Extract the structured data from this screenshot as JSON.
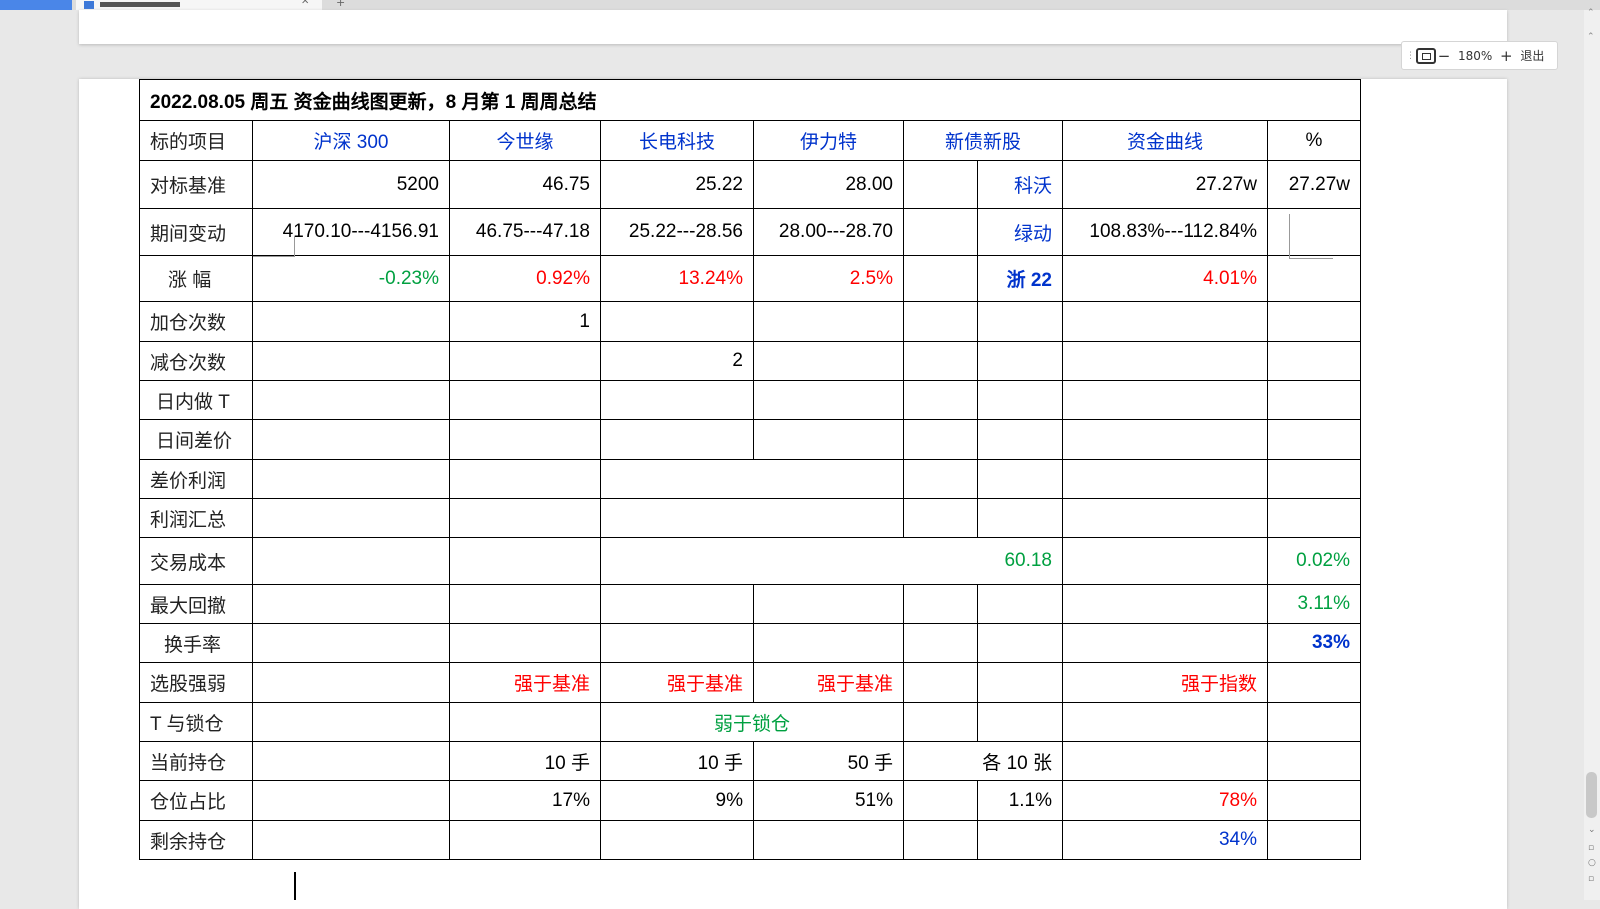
{
  "toolbar": {
    "zoom": "180%",
    "exit_label": "退出",
    "zoom_out": "−",
    "zoom_in": "+"
  },
  "title": "2022.08.05  周五  资金曲线图更新，8 月第 1 周周总结",
  "header": {
    "label": "标的项目",
    "hs300": "沪深 300",
    "jsy": "今世缘",
    "cdkj": "长电科技",
    "ylt": "伊力特",
    "xzxg": "新债新股",
    "zjqx": "资金曲线",
    "pct": "%"
  },
  "rows": {
    "benchmark": {
      "label": "对标基准",
      "hs300": "5200",
      "jsy": "46.75",
      "cdkj": "25.22",
      "ylt": "28.00",
      "xz2": "科沃",
      "zjqx": "27.27w",
      "pct": "27.27w"
    },
    "change": {
      "label": "期间变动",
      "hs300": "4170.10---4156.91",
      "jsy": "46.75---47.18",
      "cdkj": "25.22---28.56",
      "ylt": "28.00---28.70",
      "xz2": "绿动",
      "zjqx": "108.83%---112.84%"
    },
    "gain": {
      "label": "涨  幅",
      "hs300": "-0.23%",
      "jsy": "0.92%",
      "cdkj": "13.24%",
      "ylt": "2.5%",
      "xz2": "浙 22",
      "zjqx": "4.01%"
    },
    "add": {
      "label": "加仓次数",
      "jsy": "1"
    },
    "reduce": {
      "label": "减仓次数",
      "cdkj": "2"
    },
    "intraday_t": {
      "label": "日内做 T"
    },
    "interday": {
      "label": "日间差价"
    },
    "spread_profit": {
      "label": "差价利润"
    },
    "profit_total": {
      "label": "利润汇总"
    },
    "trade_cost": {
      "label": "交易成本",
      "value": "60.18",
      "pct": "0.02%"
    },
    "drawdown": {
      "label": "最大回撤",
      "pct": "3.11%"
    },
    "turnover": {
      "label": "换手率",
      "pct": "33%"
    },
    "strength": {
      "label": "选股强弱",
      "jsy": "强于基准",
      "cdkj": "强于基准",
      "ylt": "强于基准",
      "zjqx": "强于指数"
    },
    "t_lock": {
      "label": "T 与锁仓",
      "cdkj": "弱于锁仓"
    },
    "holding": {
      "label": "当前持仓",
      "jsy": "10 手",
      "cdkj": "10 手",
      "ylt": "50 手",
      "xz2": "各 10 张"
    },
    "position_ratio": {
      "label": "仓位占比",
      "jsy": "17%",
      "cdkj": "9%",
      "ylt": "51%",
      "xz2": "1.1%",
      "zjqx": "78%"
    },
    "remaining": {
      "label": "剩余持仓",
      "zjqx": "34%"
    }
  },
  "colors": {
    "blue": "#0033cc",
    "red": "#ff0000",
    "green": "#00a040"
  }
}
